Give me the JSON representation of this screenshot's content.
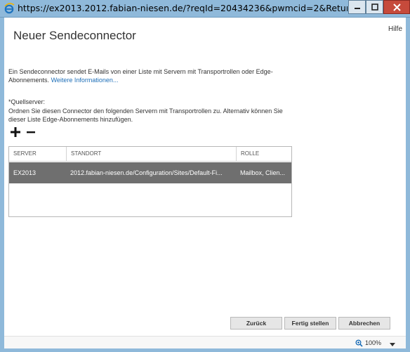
{
  "window": {
    "title": "https://ex2013.2012.fabian-niesen.de/?reqId=20434236&pwmcid=2&ReturnObjectTyp...",
    "icons": {
      "browser": "ie-icon",
      "minimize": "minimize-icon",
      "maximize": "maximize-icon",
      "close": "close-icon"
    },
    "colors": {
      "chrome": "#8fb9da",
      "close": "#c64a3b"
    }
  },
  "header": {
    "help": "Hilfe",
    "title": "Neuer Sendeconnector"
  },
  "intro": {
    "text": "Ein Sendeconnector sendet E-Mails von einer Liste mit Servern mit Transportrollen oder Edge-Abonnements.",
    "link": "Weitere Informationen..."
  },
  "source": {
    "label": "*Quellserver:",
    "description": "Ordnen Sie diesen Connector den folgenden Servern mit Transportrollen zu. Alternativ können Sie dieser Liste Edge-Abonnements hinzufügen.",
    "add_icon": "plus-icon",
    "remove_icon": "minus-icon"
  },
  "table": {
    "columns": [
      "SERVER",
      "STANDORT",
      "ROLLE"
    ],
    "rows": [
      {
        "server": "EX2013",
        "standort": "2012.fabian-niesen.de/Configuration/Sites/Default-Fi...",
        "rolle": "Mailbox, Clien..."
      }
    ],
    "selected_row_color": "#6f6f6f"
  },
  "footer": {
    "back": "Zurück",
    "finish": "Fertig stellen",
    "cancel": "Abbrechen"
  },
  "status": {
    "zoom": "100%",
    "zoom_icon": "zoom-icon"
  }
}
